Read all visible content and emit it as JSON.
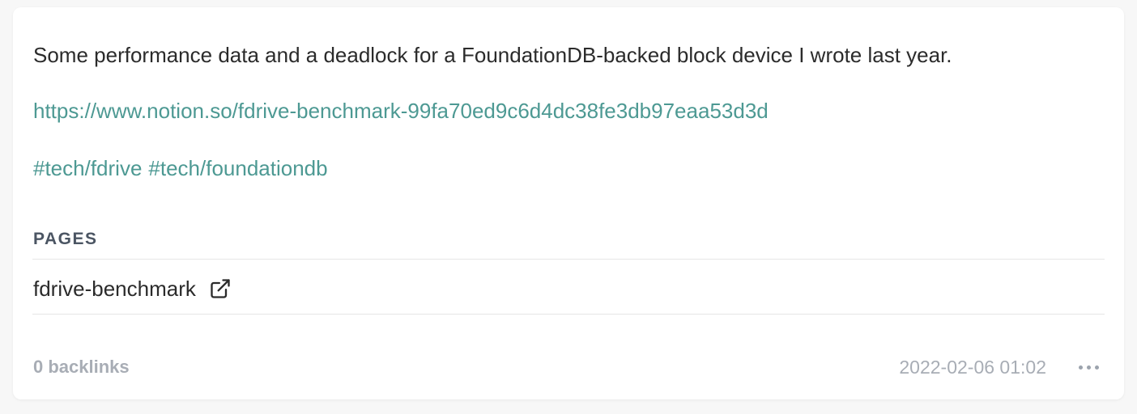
{
  "memo": {
    "content": "Some performance data and a deadlock for a FoundationDB-backed block device I wrote last year.",
    "link": "https://www.notion.so/fdrive-benchmark-99fa70ed9c6d4dc38fe3db97eaa53d3d",
    "tags": [
      "#tech/fdrive",
      "#tech/foundationdb"
    ]
  },
  "pages": {
    "heading": "PAGES",
    "items": [
      {
        "label": "fdrive-benchmark",
        "icon": "external-link-icon"
      }
    ]
  },
  "footer": {
    "backlinks": "0 backlinks",
    "timestamp": "2022-02-06 01:02",
    "more_icon": "more-dots-icon"
  },
  "colors": {
    "accent": "#4d9993",
    "text": "#2b2b2b",
    "muted": "#a8adb5",
    "heading": "#4b5563"
  }
}
